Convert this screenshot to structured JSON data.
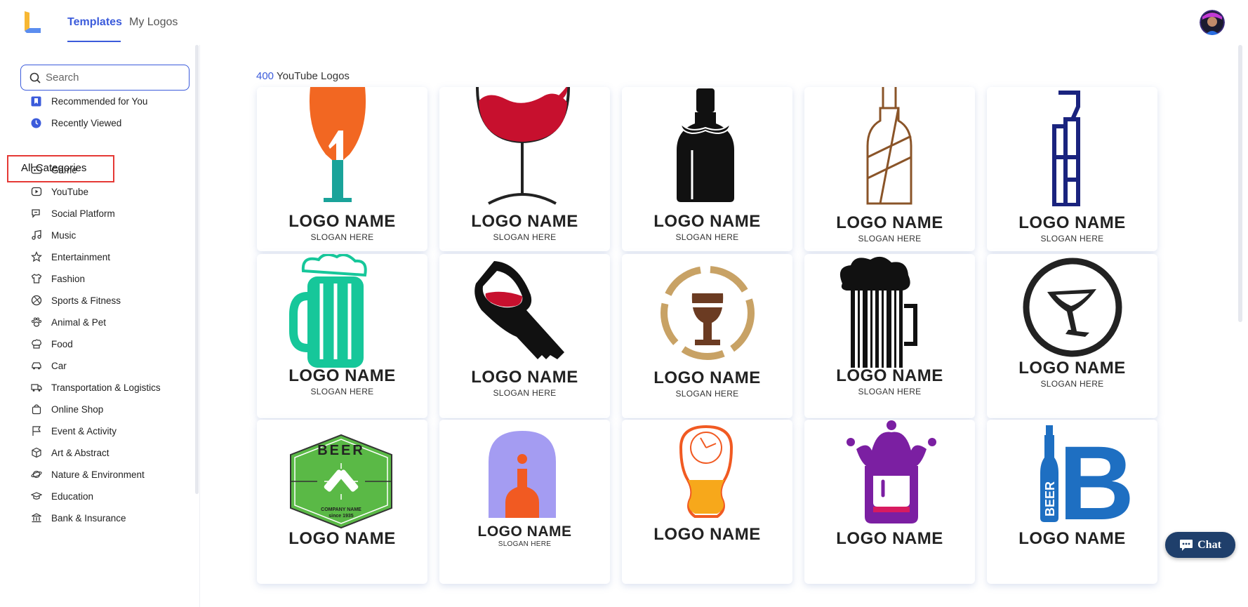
{
  "header": {
    "tabs": [
      {
        "label": "Templates",
        "active": true
      },
      {
        "label": "My Logos",
        "active": false
      }
    ],
    "accent_color": "#3b5bdb"
  },
  "sidebar": {
    "search_placeholder": "Search",
    "top_items": [
      {
        "label": "Recommended for You",
        "icon": "bookmark-icon"
      },
      {
        "label": "Recently Viewed",
        "icon": "clock-icon"
      }
    ],
    "all_categories_label": "All Categories",
    "categories": [
      {
        "label": "Game",
        "icon": "gamepad-icon"
      },
      {
        "label": "YouTube",
        "icon": "play-icon"
      },
      {
        "label": "Social Platform",
        "icon": "chat-bubbles-icon"
      },
      {
        "label": "Music",
        "icon": "music-note-icon"
      },
      {
        "label": "Entertainment",
        "icon": "star-icon"
      },
      {
        "label": "Fashion",
        "icon": "shirt-icon"
      },
      {
        "label": "Sports & Fitness",
        "icon": "ball-icon"
      },
      {
        "label": "Animal & Pet",
        "icon": "paw-icon"
      },
      {
        "label": "Food",
        "icon": "chef-hat-icon"
      },
      {
        "label": "Car",
        "icon": "car-icon"
      },
      {
        "label": "Transportation & Logistics",
        "icon": "truck-icon"
      },
      {
        "label": "Online Shop",
        "icon": "bag-icon"
      },
      {
        "label": "Event & Activity",
        "icon": "flag-icon"
      },
      {
        "label": "Art & Abstract",
        "icon": "cube-icon"
      },
      {
        "label": "Nature & Environment",
        "icon": "planet-icon"
      },
      {
        "label": "Education",
        "icon": "graduation-cap-icon"
      },
      {
        "label": "Bank & Insurance",
        "icon": "bank-icon"
      }
    ]
  },
  "main": {
    "count_number": "400",
    "count_label": "YouTube Logos",
    "logo_name": "LOGO NAME",
    "slogan": "SLOGAN HERE",
    "beer_badge_text": "BEER",
    "beer_badge_company": "COMPANY NAME",
    "beer_badge_since": "since 1935",
    "beer_bottle_text": "BEER",
    "letter_b": "B",
    "templates": [
      {
        "icon": "orange-wine-glass-icon"
      },
      {
        "icon": "red-wine-glass-icon"
      },
      {
        "icon": "mustache-bottle-icon"
      },
      {
        "icon": "outline-bottle-icon"
      },
      {
        "icon": "blue-bottle-icon"
      },
      {
        "icon": "green-beer-mug-icon"
      },
      {
        "icon": "wine-glass-key-icon"
      },
      {
        "icon": "goblet-circle-icon"
      },
      {
        "icon": "barcode-beer-mug-icon"
      },
      {
        "icon": "cocktail-circle-icon"
      },
      {
        "icon": "beer-badge-icon"
      },
      {
        "icon": "bottle-arch-icon"
      },
      {
        "icon": "beer-clock-glass-icon"
      },
      {
        "icon": "purple-crown-glass-icon"
      },
      {
        "icon": "beer-bottle-b-icon"
      }
    ]
  },
  "chat": {
    "label": "Chat"
  }
}
